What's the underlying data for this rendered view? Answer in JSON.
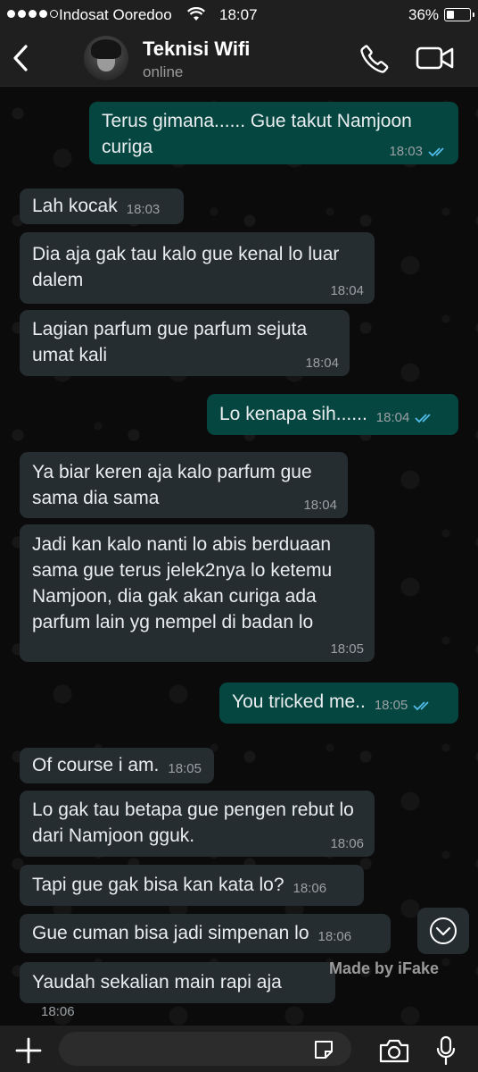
{
  "status_bar": {
    "carrier": "Indosat Ooredoo",
    "time": "18:07",
    "battery_percent": "36%",
    "battery_level": 0.36,
    "signal_bars_filled": 4,
    "signal_bars_total": 5
  },
  "header": {
    "contact_name": "Teknisi Wifi",
    "contact_status": "online",
    "back_icon": "chevron-left-icon",
    "call_icon": "phone-icon",
    "video_icon": "video-camera-icon"
  },
  "messages": [
    {
      "direction": "out",
      "text": "Terus gimana...... Gue takut Namjoon curiga",
      "time": "18:03",
      "read": true
    },
    {
      "direction": "in",
      "text": "Lah kocak",
      "time": "18:03"
    },
    {
      "direction": "in",
      "text": "Dia aja gak tau kalo gue kenal lo luar dalem",
      "time": "18:04"
    },
    {
      "direction": "in",
      "text": "Lagian parfum gue parfum sejuta umat kali",
      "time": "18:04"
    },
    {
      "direction": "out",
      "text": "Lo kenapa sih......",
      "time": "18:04",
      "read": true
    },
    {
      "direction": "in",
      "text": "Ya biar keren aja kalo parfum gue sama dia sama",
      "time": "18:04"
    },
    {
      "direction": "in",
      "text": "Jadi kan kalo nanti lo abis berduaan sama gue terus jelek2nya lo ketemu Namjoon, dia gak akan curiga ada parfum lain yg nempel di badan lo",
      "time": "18:05"
    },
    {
      "direction": "out",
      "text": "You tricked me..",
      "time": "18:05",
      "read": true
    },
    {
      "direction": "in",
      "text": "Of course i am.",
      "time": "18:05"
    },
    {
      "direction": "in",
      "text": "Lo gak tau betapa gue pengen rebut lo dari Namjoon gguk.",
      "time": "18:06"
    },
    {
      "direction": "in",
      "text": "Tapi gue gak bisa kan kata lo?",
      "time": "18:06"
    },
    {
      "direction": "in",
      "text": "Gue cuman bisa jadi simpenan lo",
      "time": "18:06"
    },
    {
      "direction": "in",
      "text": "Yaudah sekalian main rapi aja",
      "time": "18:06"
    }
  ],
  "scroll_down_icon": "chevron-down-circle-icon",
  "watermark": "Made by iFake",
  "input_bar": {
    "placeholder": "",
    "plus_icon": "plus-icon",
    "sticker_icon": "sticker-icon",
    "camera_icon": "camera-icon",
    "mic_icon": "microphone-icon"
  },
  "colors": {
    "outgoing_bubble": "#054740",
    "incoming_bubble": "#262d31",
    "read_ticks": "#53bdeb",
    "background": "#0b0b0b",
    "bar_background": "#1f1f1f"
  }
}
